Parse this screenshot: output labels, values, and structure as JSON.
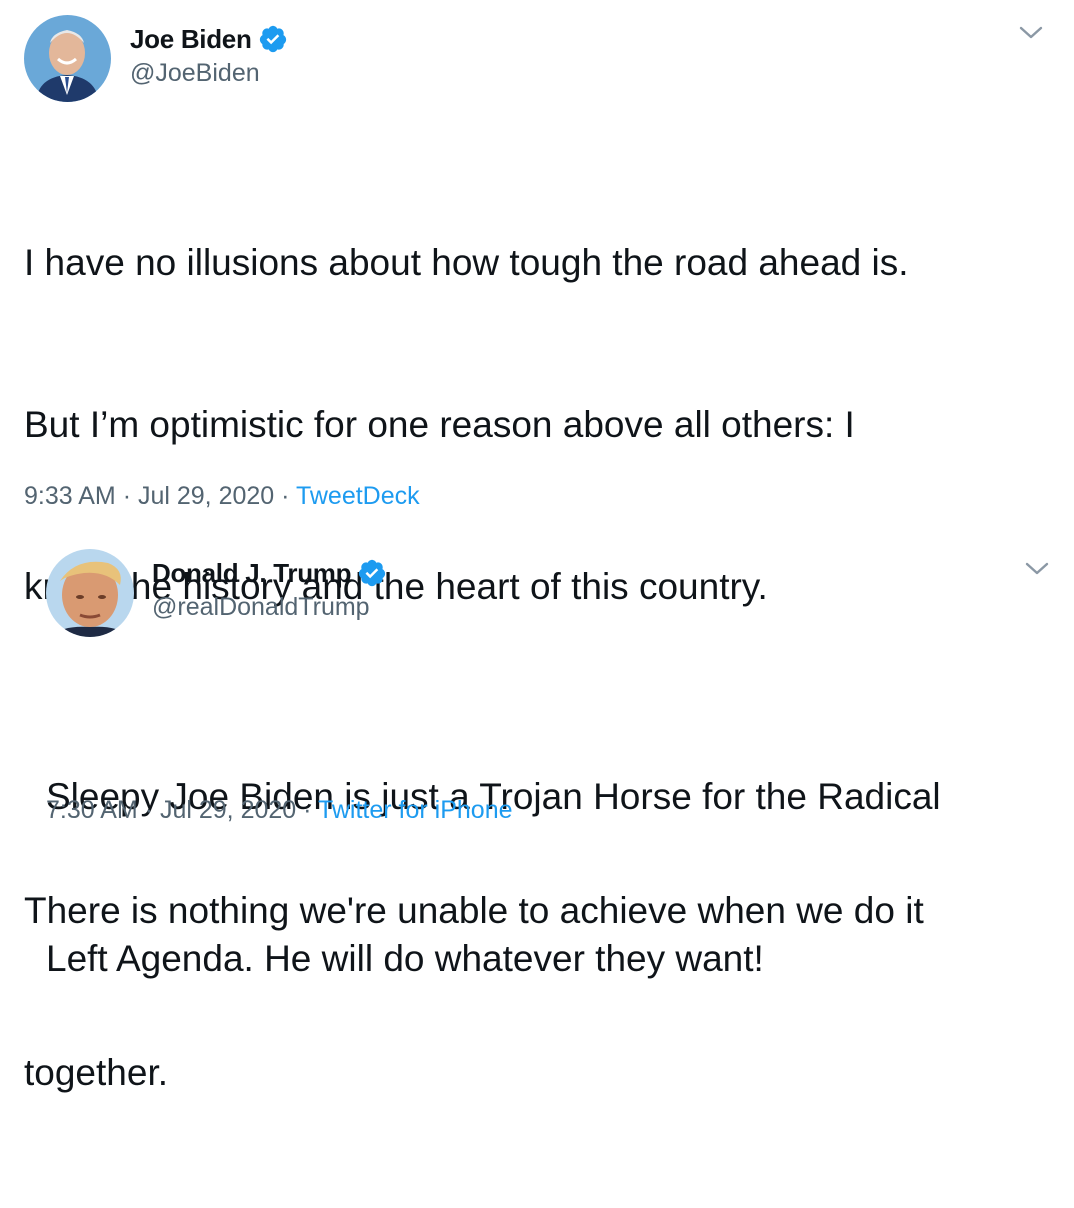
{
  "tweets": [
    {
      "display_name": "Joe Biden",
      "handle": "@JoeBiden",
      "text_lines": [
        "I have no illusions about how tough the road ahead is.",
        "But I’m optimistic for one reason above all others: I",
        "know the history and the heart of this country.",
        "",
        "There is nothing we're unable to achieve when we do it",
        "together."
      ],
      "time": "9:33 AM",
      "sep1": "·",
      "date": "Jul 29, 2020",
      "sep2": "·",
      "source": "TweetDeck",
      "avatar_icon": "joe-biden-avatar",
      "verified_icon": "verified-badge-icon"
    },
    {
      "display_name": "Donald J. Trump",
      "handle": "@realDonaldTrump",
      "text_lines": [
        "Sleepy Joe Biden is just a Trojan Horse for the Radical",
        "Left Agenda. He will do whatever they want!"
      ],
      "time": "7:30 AM",
      "sep1": "·",
      "date": "Jul 29, 2020",
      "sep2": "·",
      "source": "Twitter for iPhone",
      "avatar_icon": "donald-trump-avatar",
      "verified_icon": "verified-badge-icon"
    }
  ],
  "colors": {
    "text": "#0f1419",
    "secondary": "#536471",
    "link": "#1d9bf0",
    "verified": "#1d9bf0"
  }
}
